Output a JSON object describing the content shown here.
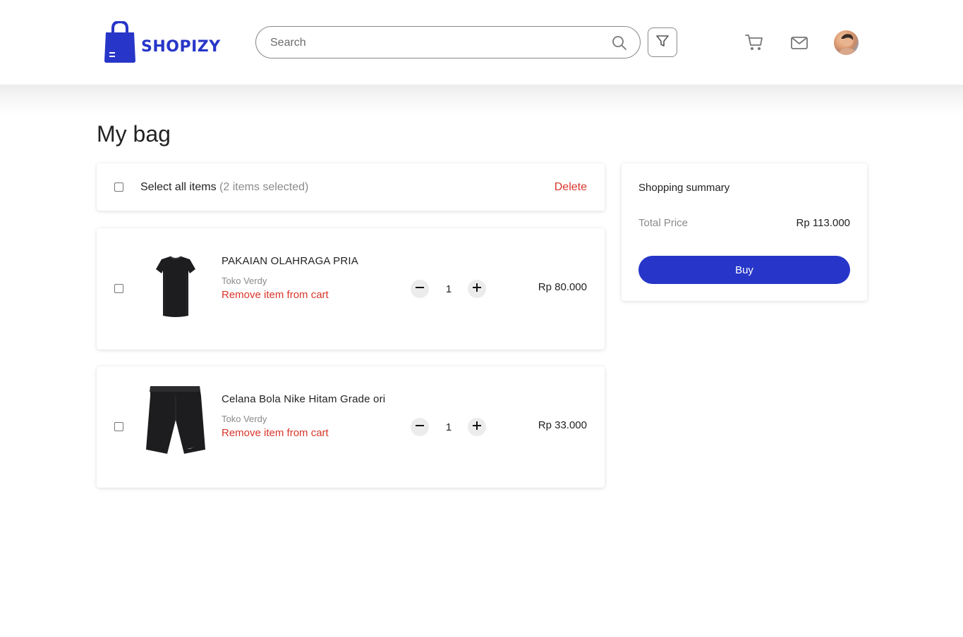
{
  "header": {
    "brand": "SHOPIZY",
    "search": {
      "placeholder": "Search",
      "value": ""
    },
    "icons": [
      "search-icon",
      "filter-icon",
      "cart-icon",
      "mail-icon",
      "avatar"
    ],
    "brand_color": "#2736c8"
  },
  "page": {
    "title": "My bag"
  },
  "select_all": {
    "label": "Select all items",
    "count_text": "(2 items selected)",
    "delete_label": "Delete",
    "checked": false
  },
  "cart_items": [
    {
      "name": "PAKAIAN OLAHRAGA PRIA",
      "store": "Toko Verdy",
      "remove_label": "Remove item from cart",
      "quantity": "1",
      "price": "Rp 80.000",
      "image": "black-sport-tshirt",
      "checked": false
    },
    {
      "name": "Celana Bola Nike Hitam Grade ori",
      "store": "Toko Verdy",
      "remove_label": "Remove item from cart",
      "quantity": "1",
      "price": "Rp 33.000",
      "image": "black-nike-shorts",
      "checked": false
    }
  ],
  "summary": {
    "title": "Shopping summary",
    "total_label": "Total Price",
    "total_value": "Rp 113.000",
    "buy_label": "Buy"
  },
  "colors": {
    "accent": "#2736c8",
    "danger": "#d9352b",
    "muted_text": "#8a8a8a"
  }
}
